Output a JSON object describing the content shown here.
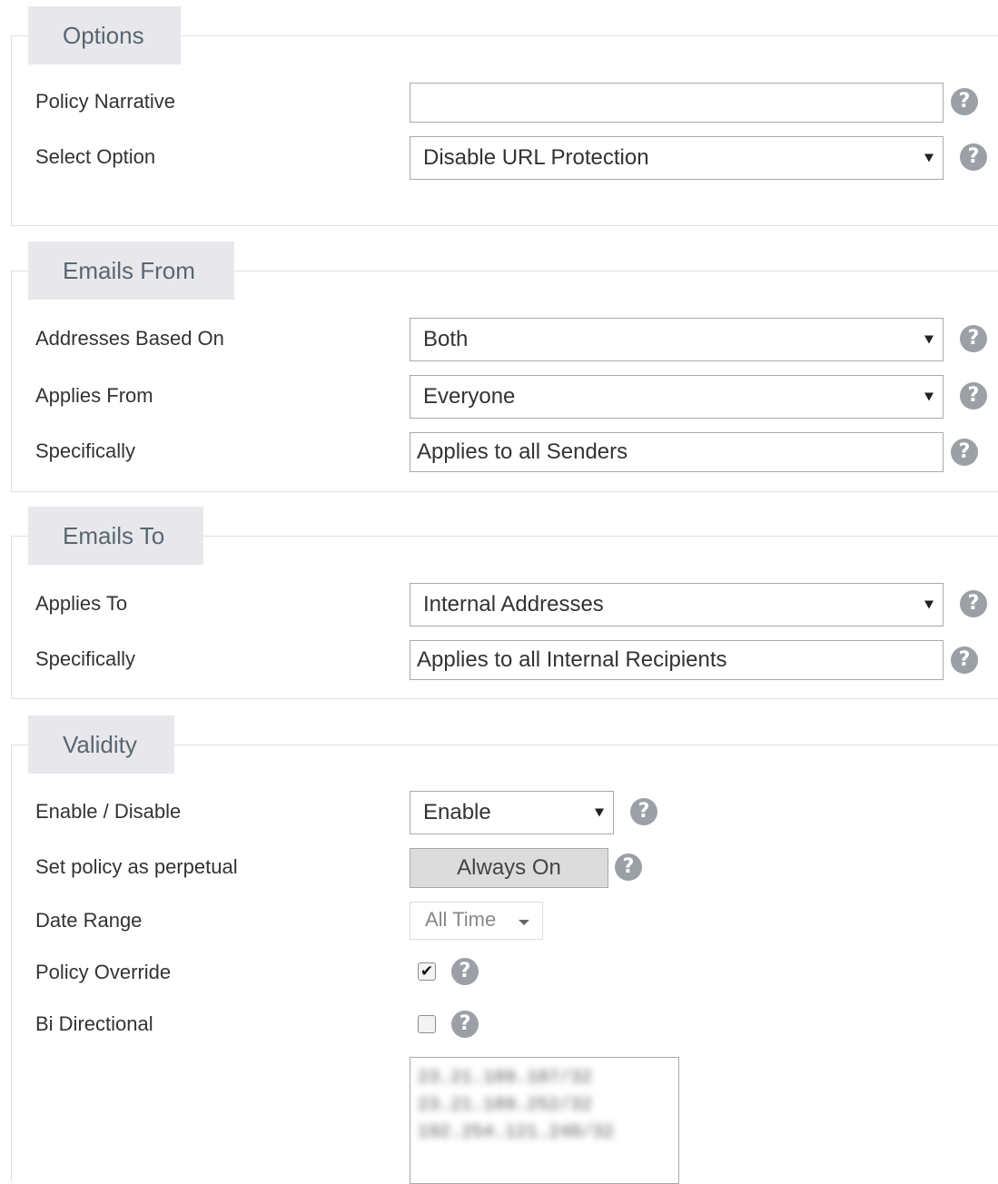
{
  "options": {
    "legend": "Options",
    "policy_narrative_label": "Policy Narrative",
    "policy_narrative_value": "",
    "select_option_label": "Select Option",
    "select_option_value": "Disable URL Protection"
  },
  "emails_from": {
    "legend": "Emails From",
    "addresses_based_on_label": "Addresses Based On",
    "addresses_based_on_value": "Both",
    "applies_from_label": "Applies From",
    "applies_from_value": "Everyone",
    "specifically_label": "Specifically",
    "specifically_value": "Applies to all Senders"
  },
  "emails_to": {
    "legend": "Emails To",
    "applies_to_label": "Applies To",
    "applies_to_value": "Internal Addresses",
    "specifically_label": "Specifically",
    "specifically_value": "Applies to all Internal Recipients"
  },
  "validity": {
    "legend": "Validity",
    "enable_disable_label": "Enable / Disable",
    "enable_disable_value": "Enable",
    "perpetual_label": "Set policy as perpetual",
    "perpetual_button": "Always On",
    "date_range_label": "Date Range",
    "date_range_value": "All Time",
    "policy_override_label": "Policy Override",
    "policy_override_checked": true,
    "bi_directional_label": "Bi Directional",
    "bi_directional_checked": false,
    "ip_ranges": [
      "23.21.189.107/32",
      "23.21.189.252/32",
      "192.254.121.248/32"
    ]
  },
  "help_glyph": "?",
  "check_glyph": "✔",
  "icons": {
    "help": "help-circle-icon",
    "dropdown": "caret-down-icon",
    "check": "checkmark-icon"
  },
  "colors": {
    "legend_bg": "#e8e8ec",
    "legend_text": "#5a6670",
    "help_icon": "#9aa0a6",
    "border": "#a9a9a9",
    "toggle_bg": "#dcdcdc"
  }
}
